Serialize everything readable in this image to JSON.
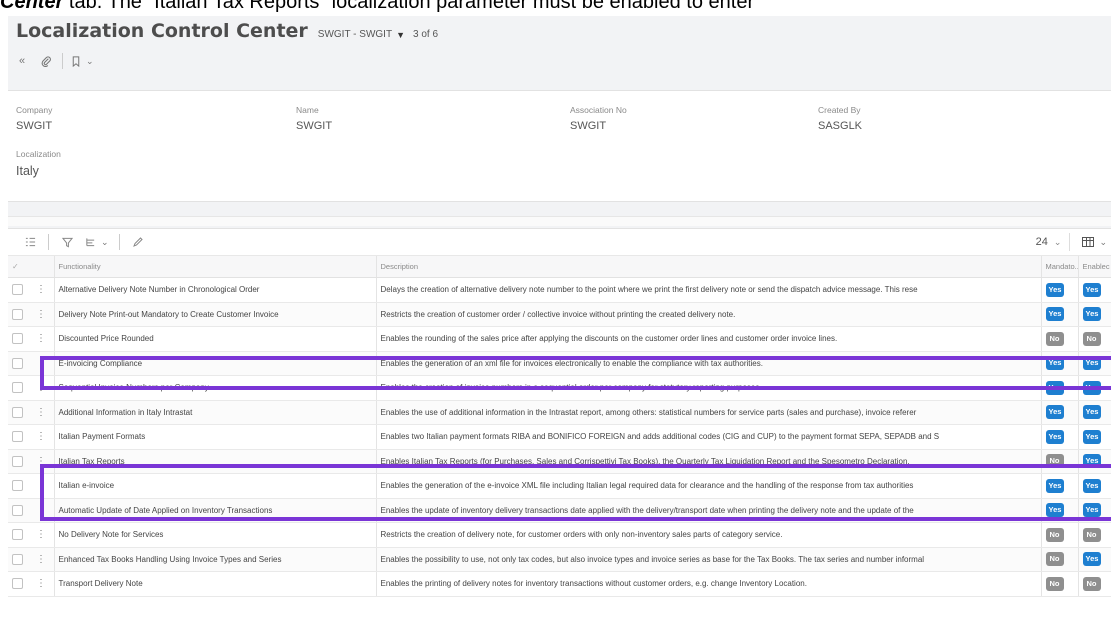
{
  "caption": {
    "bold_text": "Center",
    "rest_text": " tab. The “Italian Tax Reports” localization parameter must be enabled to enter"
  },
  "header": {
    "title": "Localization Control Center",
    "record": "SWGIT - SWGIT",
    "count": "3 of 6"
  },
  "fields": {
    "company_label": "Company",
    "company_value": "SWGIT",
    "name_label": "Name",
    "name_value": "SWGIT",
    "assoc_label": "Association No",
    "assoc_value": "SWGIT",
    "created_label": "Created By",
    "created_value": "SASGLK",
    "localization_label": "Localization",
    "localization_value": "Italy"
  },
  "grid": {
    "page_size": "24",
    "columns": {
      "functionality": "Functionality",
      "description": "Description",
      "mandatory": "Mandato...",
      "enabled": "Enablec"
    },
    "rows": [
      {
        "functionality": "Alternative Delivery Note Number in Chronological Order",
        "description": "Delays the creation of alternative delivery note number to the point where we print the first delivery note or send the dispatch advice message. This rese",
        "mandatory": "Yes",
        "enabled": "Yes"
      },
      {
        "functionality": "Delivery Note Print-out Mandatory to Create Customer Invoice",
        "description": "Restricts the creation of customer order / collective invoice without printing the created delivery note.",
        "mandatory": "Yes",
        "enabled": "Yes"
      },
      {
        "functionality": "Discounted Price Rounded",
        "description": "Enables the rounding of the sales price after applying the discounts on the customer order lines and customer order invoice lines.",
        "mandatory": "No",
        "enabled": "No"
      },
      {
        "functionality": "E-invoicing Compliance",
        "description": "Enables the generation of an xml file for invoices electronically to enable the compliance with tax authorities.",
        "mandatory": "Yes",
        "enabled": "Yes"
      },
      {
        "functionality": "Sequential Invoice Numbers per Company",
        "description": "Enables the creation of invoice numbers in a sequential order per company for statutory reporting purposes.",
        "mandatory": "Yes",
        "enabled": "Yes"
      },
      {
        "functionality": "Additional Information in Italy Intrastat",
        "description": "Enables the use of additional information in the Intrastat report, among others: statistical numbers for service parts (sales and purchase), invoice referer",
        "mandatory": "Yes",
        "enabled": "Yes"
      },
      {
        "functionality": "Italian Payment Formats",
        "description": "Enables two Italian payment formats RIBA and BONIFICO FOREIGN and adds additional codes (CIG and CUP) to the payment format SEPA, SEPADB and S",
        "mandatory": "Yes",
        "enabled": "Yes"
      },
      {
        "functionality": "Italian Tax Reports",
        "description": "Enables Italian Tax Reports (for Purchases, Sales and Corrispettivi Tax Books), the Quarterly Tax Liquidation Report and the Spesometro Declaration.",
        "mandatory": "No",
        "enabled": "Yes"
      },
      {
        "functionality": "Italian e-invoice",
        "description": "Enables the generation of the e-invoice XML file including Italian legal required data for clearance and the handling of the response from tax authorities",
        "mandatory": "Yes",
        "enabled": "Yes"
      },
      {
        "functionality": "Automatic Update of Date Applied on Inventory Transactions",
        "description": "Enables the update of inventory delivery transactions date applied with the delivery/transport date when printing the delivery note and the update of the",
        "mandatory": "Yes",
        "enabled": "Yes"
      },
      {
        "functionality": "No Delivery Note for Services",
        "description": "Restricts the creation of delivery note, for customer orders with only non-inventory sales parts of category service.",
        "mandatory": "No",
        "enabled": "No"
      },
      {
        "functionality": "Enhanced Tax Books Handling Using Invoice Types and Series",
        "description": "Enables the possibility to use, not only tax codes, but also invoice types and invoice series as base for the Tax Books. The tax series and number informal",
        "mandatory": "No",
        "enabled": "Yes"
      },
      {
        "functionality": "Transport Delivery Note",
        "description": "Enables the printing of delivery notes for inventory transactions without customer orders, e.g. change Inventory Location.",
        "mandatory": "No",
        "enabled": "No"
      }
    ]
  },
  "colors": {
    "highlight": "#7a35d6",
    "yes_badge": "#1e7fd0",
    "no_badge": "#8f8f8f"
  },
  "icons": [
    "chevrons-left-icon",
    "paperclip-icon",
    "bookmark-icon",
    "chevron-down-icon",
    "list-icon",
    "filter-icon",
    "column-chooser-icon",
    "edit-icon",
    "table-view-icon",
    "kebab-icon"
  ]
}
